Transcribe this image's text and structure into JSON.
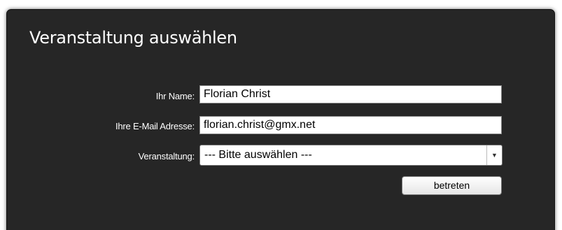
{
  "panel": {
    "title": "Veranstaltung auswählen"
  },
  "form": {
    "name_label": "Ihr Name:",
    "name_value": "Florian Christ",
    "email_label": "Ihre E-Mail Adresse:",
    "email_value": "florian.christ@gmx.net",
    "event_label": "Veranstaltung:",
    "event_selected": "--- Bitte auswählen ---",
    "submit_label": "betreten"
  },
  "colors": {
    "panel_background": "#262626",
    "text": "#ffffff"
  },
  "icons": {
    "dropdown": "chevron-down-icon"
  }
}
